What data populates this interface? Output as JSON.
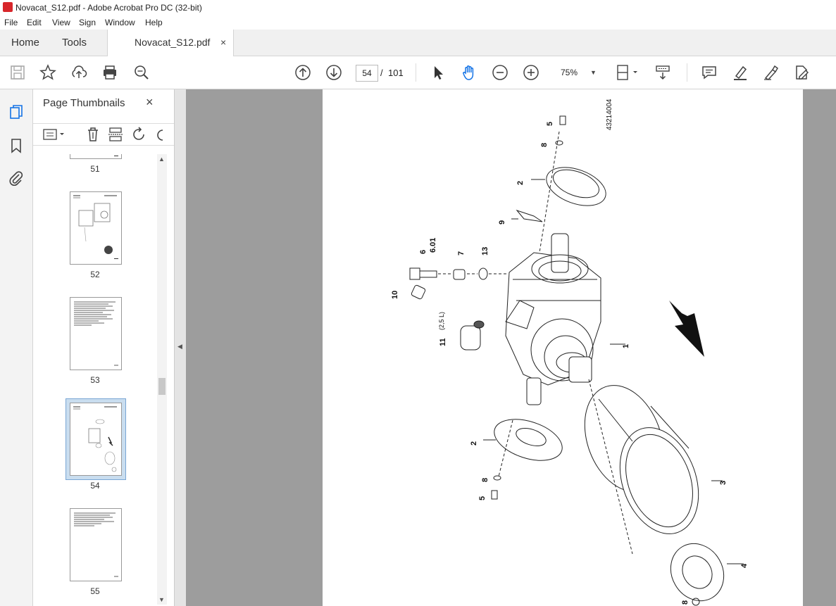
{
  "window": {
    "title": "Novacat_S12.pdf - Adobe Acrobat Pro DC (32-bit)"
  },
  "menu": {
    "items": [
      "File",
      "Edit",
      "View",
      "Sign",
      "Window",
      "Help"
    ]
  },
  "tabs": {
    "home": "Home",
    "tools": "Tools",
    "document": "Novacat_S12.pdf",
    "close": "×"
  },
  "toolbar": {
    "page_current": "54",
    "page_separator": "/",
    "page_total": "101",
    "zoom": "75%",
    "icons": [
      "save-icon",
      "star-icon",
      "upload-icon",
      "print-icon",
      "search-zoom-icon",
      "prev-page-icon",
      "next-page-icon",
      "select-arrow-icon",
      "hand-icon",
      "zoom-out-icon",
      "zoom-in-icon",
      "zoom-dropdown-icon",
      "page-fit-icon",
      "scroll-mode-icon",
      "comment-icon",
      "highlight-icon",
      "sign-icon",
      "edit-pdf-icon"
    ]
  },
  "panel": {
    "title": "Page Thumbnails",
    "close": "×",
    "thumbnails": [
      {
        "label": "51"
      },
      {
        "label": "52"
      },
      {
        "label": "53"
      },
      {
        "label": "54",
        "selected": true
      },
      {
        "label": "55"
      }
    ]
  },
  "diagram": {
    "drawing_number": "43214004",
    "parts": [
      "1",
      "2",
      "2",
      "3",
      "4",
      "5",
      "5",
      "6",
      "6.01",
      "7",
      "8",
      "8",
      "8",
      "9",
      "10",
      "11",
      "(2,5 L)",
      "13"
    ]
  }
}
